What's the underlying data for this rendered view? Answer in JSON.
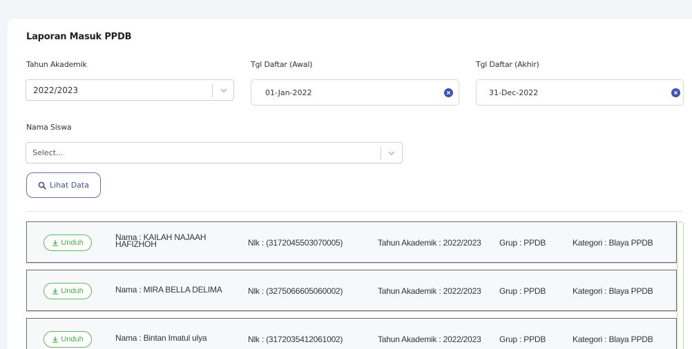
{
  "page": {
    "title": "Laporan Masuk PPDB"
  },
  "filters": {
    "tahun_label": "Tahun Akademik",
    "tahun_value": "2022/2023",
    "tgl_awal_label": "Tgl Daftar (Awal)",
    "tgl_awal_value": "01-Jan-2022",
    "tgl_akhir_label": "Tgl Daftar (Akhir)",
    "tgl_akhir_value": "31-Dec-2022",
    "nama_label": "Nama Siswa",
    "nama_placeholder": "Select..."
  },
  "actions": {
    "lihat_label": "Lihat Data"
  },
  "rows": [
    {
      "unduh": "Unduh",
      "nama": "Nama : KAILAH NAJAAH HAFIZHOH",
      "nik": "Nlk : (3172045503070005)",
      "tahun": "Tahun Akademik : 2022/2023",
      "grup": "Grup : PPDB",
      "kategori": "Kategori : Blaya PPDB"
    },
    {
      "unduh": "Unduh",
      "nama": "Nama : MIRA BELLA DELIMA",
      "nik": "Nlk : (3275066605060002)",
      "tahun": "Tahun Akademik : 2022/2023",
      "grup": "Grup : PPDB",
      "kategori": "Kategori : Blaya PPDB"
    },
    {
      "unduh": "Unduh",
      "nama": "Nama : Bintan Imatul ulya",
      "nik": "Nlk : (3172035412061002)",
      "tahun": "Tahun Akademik : 2022/2023",
      "grup": "Grup : PPDB",
      "kategori": "Kategori : Blaya PPDB"
    }
  ],
  "icons": {
    "search": "search-icon",
    "download": "download-icon",
    "clear": "clear-icon",
    "chevron": "chevron-down-icon"
  },
  "colors": {
    "accent": "#4a4f8a",
    "download_green": "#4caf50",
    "clear_blue": "#3f51b5"
  }
}
